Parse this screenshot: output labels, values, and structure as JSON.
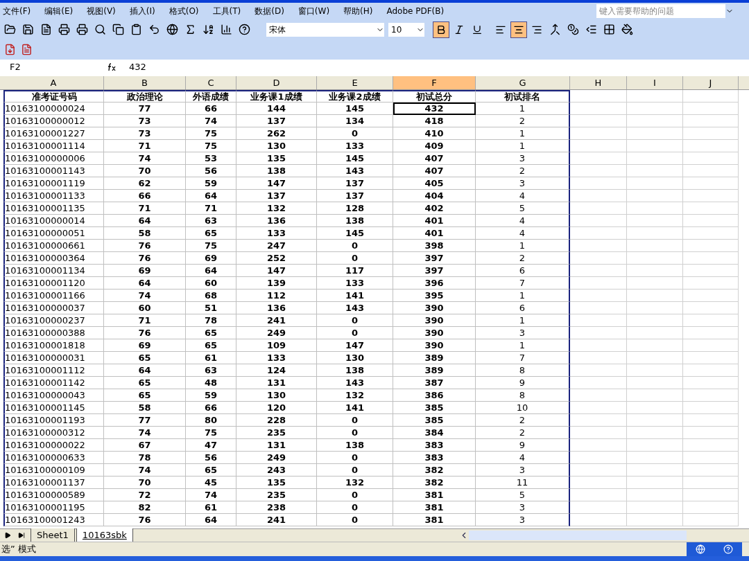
{
  "menu": [
    "文件(F)",
    "编辑(E)",
    "视图(V)",
    "插入(I)",
    "格式(O)",
    "工具(T)",
    "数据(D)",
    "窗口(W)",
    "帮助(H)",
    "Adobe PDF(B)"
  ],
  "help_search": {
    "placeholder": "键入需要帮助的问题"
  },
  "font": {
    "name": "宋体",
    "size": "10"
  },
  "format": {
    "bold": true,
    "italic": false,
    "underline": false,
    "align_left": false,
    "align_center": true,
    "align_right": false
  },
  "name_box": "F2",
  "formula": "432",
  "columns": [
    {
      "label": "A",
      "selected": false
    },
    {
      "label": "B",
      "selected": false
    },
    {
      "label": "C",
      "selected": false
    },
    {
      "label": "D",
      "selected": false
    },
    {
      "label": "E",
      "selected": false
    },
    {
      "label": "F",
      "selected": true
    },
    {
      "label": "G",
      "selected": false
    },
    {
      "label": "H",
      "selected": false
    },
    {
      "label": "I",
      "selected": false
    },
    {
      "label": "J",
      "selected": false
    }
  ],
  "headers": [
    "准考证号码",
    "政治理论",
    "外语成绩",
    "业务课1成绩",
    "业务课2成绩",
    "初试总分",
    "初试排名"
  ],
  "rows": [
    [
      "10163100000024",
      "77",
      "66",
      "144",
      "145",
      "432",
      "1"
    ],
    [
      "10163100000012",
      "73",
      "74",
      "137",
      "134",
      "418",
      "2"
    ],
    [
      "10163100001227",
      "73",
      "75",
      "262",
      "0",
      "410",
      "1"
    ],
    [
      "10163100001114",
      "71",
      "75",
      "130",
      "133",
      "409",
      "1"
    ],
    [
      "10163100000006",
      "74",
      "53",
      "135",
      "145",
      "407",
      "3"
    ],
    [
      "10163100001143",
      "70",
      "56",
      "138",
      "143",
      "407",
      "2"
    ],
    [
      "10163100001119",
      "62",
      "59",
      "147",
      "137",
      "405",
      "3"
    ],
    [
      "10163100001133",
      "66",
      "64",
      "137",
      "137",
      "404",
      "4"
    ],
    [
      "10163100001135",
      "71",
      "71",
      "132",
      "128",
      "402",
      "5"
    ],
    [
      "10163100000014",
      "64",
      "63",
      "136",
      "138",
      "401",
      "4"
    ],
    [
      "10163100000051",
      "58",
      "65",
      "133",
      "145",
      "401",
      "4"
    ],
    [
      "10163100000661",
      "76",
      "75",
      "247",
      "0",
      "398",
      "1"
    ],
    [
      "10163100000364",
      "76",
      "69",
      "252",
      "0",
      "397",
      "2"
    ],
    [
      "10163100001134",
      "69",
      "64",
      "147",
      "117",
      "397",
      "6"
    ],
    [
      "10163100001120",
      "64",
      "60",
      "139",
      "133",
      "396",
      "7"
    ],
    [
      "10163100001166",
      "74",
      "68",
      "112",
      "141",
      "395",
      "1"
    ],
    [
      "10163100000037",
      "60",
      "51",
      "136",
      "143",
      "390",
      "6"
    ],
    [
      "10163100000237",
      "71",
      "78",
      "241",
      "0",
      "390",
      "1"
    ],
    [
      "10163100000388",
      "76",
      "65",
      "249",
      "0",
      "390",
      "3"
    ],
    [
      "10163100001818",
      "69",
      "65",
      "109",
      "147",
      "390",
      "1"
    ],
    [
      "10163100000031",
      "65",
      "61",
      "133",
      "130",
      "389",
      "7"
    ],
    [
      "10163100001112",
      "64",
      "63",
      "124",
      "138",
      "389",
      "8"
    ],
    [
      "10163100001142",
      "65",
      "48",
      "131",
      "143",
      "387",
      "9"
    ],
    [
      "10163100000043",
      "65",
      "59",
      "130",
      "132",
      "386",
      "8"
    ],
    [
      "10163100001145",
      "58",
      "66",
      "120",
      "141",
      "385",
      "10"
    ],
    [
      "10163100001193",
      "77",
      "80",
      "228",
      "0",
      "385",
      "2"
    ],
    [
      "10163100000312",
      "74",
      "75",
      "235",
      "0",
      "384",
      "2"
    ],
    [
      "10163100000022",
      "67",
      "47",
      "131",
      "138",
      "383",
      "9"
    ],
    [
      "10163100000633",
      "78",
      "56",
      "249",
      "0",
      "383",
      "4"
    ],
    [
      "10163100000109",
      "74",
      "65",
      "243",
      "0",
      "382",
      "3"
    ],
    [
      "10163100001137",
      "70",
      "45",
      "135",
      "132",
      "382",
      "11"
    ],
    [
      "10163100000589",
      "72",
      "74",
      "235",
      "0",
      "381",
      "5"
    ],
    [
      "10163100001195",
      "82",
      "61",
      "238",
      "0",
      "381",
      "3"
    ],
    [
      "10163100001243",
      "76",
      "64",
      "241",
      "0",
      "381",
      "3"
    ]
  ],
  "sheet_tabs": [
    {
      "label": "Sheet1",
      "selected": false
    },
    {
      "label": "10163sbk",
      "selected": true
    }
  ],
  "status": "选” 模式"
}
